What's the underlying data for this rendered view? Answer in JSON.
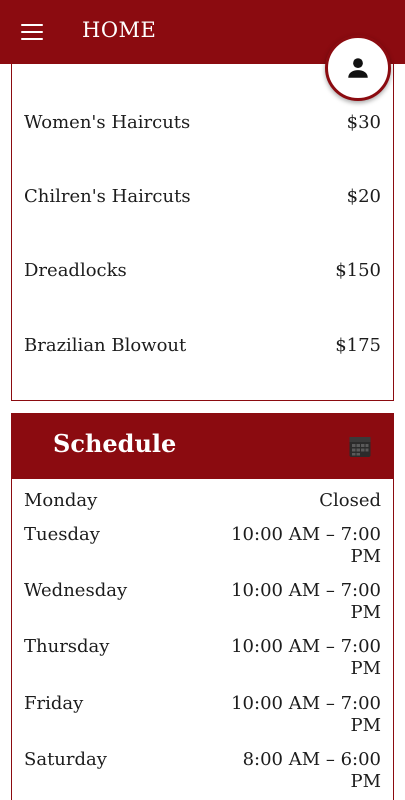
{
  "appbar": {
    "title": "HOME",
    "menu_icon": "menu-icon",
    "profile_icon": "person-icon"
  },
  "colors": {
    "primary": "#8b0b10",
    "surface": "#ffffff",
    "text": "#1c1c1c"
  },
  "services": [
    {
      "name": "Women's Haircuts",
      "price": "$30"
    },
    {
      "name": "Chilren's Haircuts",
      "price": "$20"
    },
    {
      "name": "Dreadlocks",
      "price": "$150"
    },
    {
      "name": "Brazilian Blowout",
      "price": "$175"
    }
  ],
  "schedule": {
    "title": "Schedule",
    "icon": "calendar-icon",
    "days": [
      {
        "day": "Monday",
        "hours": "Closed"
      },
      {
        "day": "Tuesday",
        "hours": "10:00 AM – 7:00 PM"
      },
      {
        "day": "Wednesday",
        "hours": "10:00 AM – 7:00 PM"
      },
      {
        "day": "Thursday",
        "hours": "10:00 AM – 7:00 PM"
      },
      {
        "day": "Friday",
        "hours": "10:00 AM – 7:00 PM"
      },
      {
        "day": "Saturday",
        "hours": "8:00 AM – 6:00 PM"
      }
    ]
  }
}
